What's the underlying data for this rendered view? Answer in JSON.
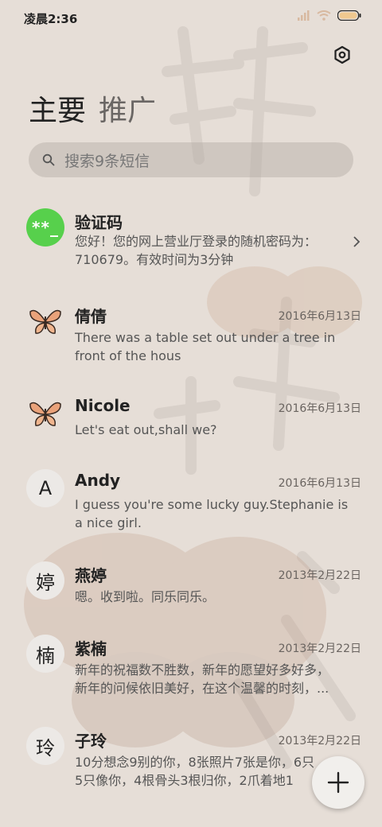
{
  "status_bar": {
    "time": "凌晨2:36"
  },
  "tabs": [
    {
      "label": "主要",
      "active": true
    },
    {
      "label": "推广",
      "active": false
    }
  ],
  "search": {
    "placeholder": "搜索9条短信"
  },
  "messages": [
    {
      "name": "验证码",
      "avatar": "**_",
      "avatar_type": "badge",
      "date": "",
      "preview_lines": [
        "您好！您的网上营业厅登录的随机密码为：",
        "710679。有效时间为3分钟"
      ]
    },
    {
      "name": "倩倩",
      "avatar": "butterfly-icon",
      "avatar_type": "icon",
      "date": "2016年6月13日",
      "preview_lines": [
        "There was a table set out under a tree in",
        "front of the hous"
      ]
    },
    {
      "name": "Nicole",
      "avatar": "butterfly-icon",
      "avatar_type": "icon",
      "date": "2016年6月13日",
      "preview_lines": [
        "Let's eat out,shall we?"
      ]
    },
    {
      "name": "Andy",
      "avatar": "A",
      "avatar_type": "letter",
      "date": "2016年6月13日",
      "preview_lines": [
        "I guess you're some lucky guy.Stephanie is",
        "a nice girl."
      ]
    },
    {
      "name": "燕婷",
      "avatar": "婷",
      "avatar_type": "letter",
      "date": "2013年2月22日",
      "preview_lines": [
        "嗯。收到啦。同乐同乐。"
      ]
    },
    {
      "name": "紫楠",
      "avatar": "楠",
      "avatar_type": "letter",
      "date": "2013年2月22日",
      "preview_lines": [
        "新年的祝福数不胜数，新年的愿望好多好多，",
        "新年的问候依旧美好，在这个温馨的时刻，..."
      ]
    },
    {
      "name": "子玲",
      "avatar": "玲",
      "avatar_type": "letter",
      "date": "2013年2月22日",
      "preview_lines": [
        "10分想念9别的你，8张照片7张是你，6只",
        "5只像你，4根骨头3根归你，2爪着地1"
      ]
    }
  ],
  "colors": {
    "background": "#e6ded7",
    "badge_green": "#57d04c"
  },
  "icons": {
    "settings": "gear-icon",
    "search": "search-icon",
    "compose": "plus-icon",
    "chevron": "chevron-right-icon"
  }
}
